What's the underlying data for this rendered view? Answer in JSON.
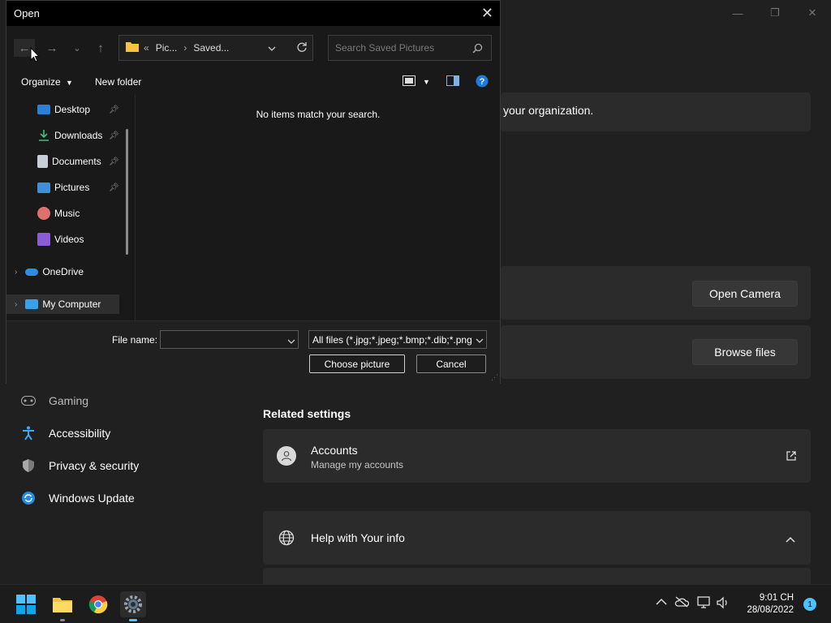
{
  "settings": {
    "org_text": "your organization.",
    "open_camera": "Open Camera",
    "browse_files": "Browse files",
    "nav": [
      {
        "label": "Gaming",
        "icon": "gaming-icon"
      },
      {
        "label": "Accessibility",
        "icon": "accessibility-icon"
      },
      {
        "label": "Privacy & security",
        "icon": "shield-icon"
      },
      {
        "label": "Windows Update",
        "icon": "windows-update-icon"
      }
    ],
    "related_settings": "Related settings",
    "accounts_title": "Accounts",
    "accounts_sub": "Manage my accounts",
    "help_title": "Help with Your info"
  },
  "dialog": {
    "title": "Open",
    "breadcrumb": [
      "«",
      "Pic...",
      "Saved..."
    ],
    "search_placeholder": "Search Saved Pictures",
    "organize": "Organize",
    "new_folder": "New folder",
    "tree": [
      {
        "label": "Desktop",
        "icon": "desktop-icon",
        "pinned": true
      },
      {
        "label": "Downloads",
        "icon": "downloads-icon",
        "pinned": true
      },
      {
        "label": "Documents",
        "icon": "documents-icon",
        "pinned": true
      },
      {
        "label": "Pictures",
        "icon": "pictures-icon",
        "pinned": true
      },
      {
        "label": "Music",
        "icon": "music-icon",
        "pinned": false
      },
      {
        "label": "Videos",
        "icon": "videos-icon",
        "pinned": false
      },
      {
        "label": "OneDrive",
        "icon": "onedrive-icon",
        "pinned": false
      },
      {
        "label": "My Computer",
        "icon": "computer-icon",
        "pinned": false
      }
    ],
    "empty_message": "No items match your search.",
    "file_name_label": "File name:",
    "file_name_value": "",
    "file_type": "All files (*.jpg;*.jpeg;*.bmp;*.dib;*.png",
    "choose_button": "Choose picture",
    "cancel_button": "Cancel"
  },
  "taskbar": {
    "time": "9:01 CH",
    "date": "28/08/2022",
    "notification_count": "1"
  }
}
